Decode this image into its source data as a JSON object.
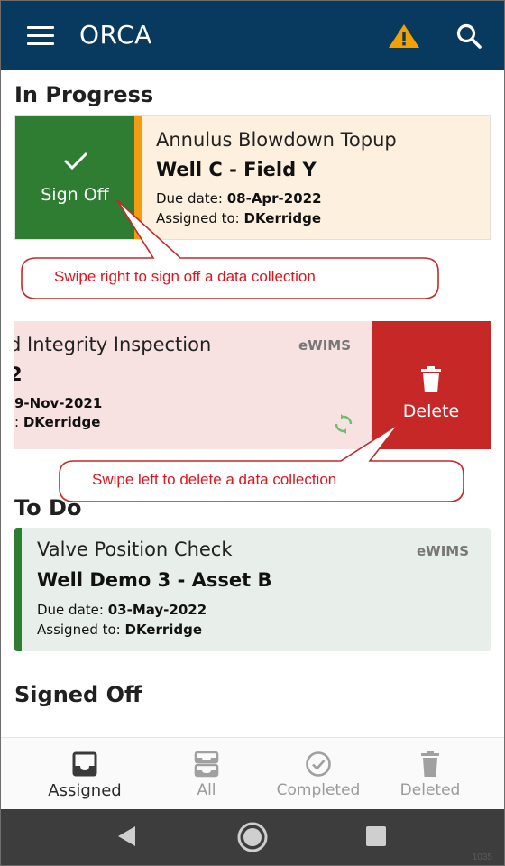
{
  "app_bar": {
    "title": "ORCA",
    "menu_icon": "hamburger-menu-icon",
    "alert_icon": "warning-triangle-icon",
    "search_icon": "search-icon",
    "background_color": "#073a5e",
    "alert_color": "#f5a000"
  },
  "sections": {
    "in_progress": "In Progress",
    "to_do": "To Do",
    "signed_off": "Signed Off"
  },
  "in_progress_cards": [
    {
      "type": "Annulus Blowdown Topup",
      "well": "Well C - Field Y",
      "due_label": "Due date:",
      "due_value": "08-Apr-2022",
      "assigned_label": "Assigned to:",
      "assigned_value": "DKerridge",
      "swipe_action": "Sign Off",
      "swipe_icon": "checkmark-icon",
      "accent_color": "#f39c12"
    },
    {
      "type": "d Integrity Inspection",
      "source": "eWIMS",
      "well": "2",
      "due_value": "9-Nov-2021",
      "assigned_label": ":",
      "assigned_value": "DKerridge",
      "sync_icon": "sync-icon",
      "swipe_action": "Delete",
      "swipe_icon": "trash-icon"
    }
  ],
  "callouts": {
    "sign_off_hint": "Swipe right to sign off a data collection",
    "delete_hint": "Swipe left to delete a data collection"
  },
  "to_do_cards": [
    {
      "type": "Valve Position Check",
      "source": "eWIMS",
      "well": "Well Demo 3 - Asset B",
      "due_label": "Due date:",
      "due_value": "03-May-2022",
      "assigned_label": "Assigned to:",
      "assigned_value": "DKerridge",
      "accent_color": "#2e7d32"
    }
  ],
  "bottom_nav": {
    "active": "Assigned",
    "items": [
      {
        "label": "Assigned",
        "icon": "inbox-icon"
      },
      {
        "label": "All",
        "icon": "stacked-inbox-icon"
      },
      {
        "label": "Completed",
        "icon": "check-circle-icon"
      },
      {
        "label": "Deleted",
        "icon": "trash-icon"
      }
    ]
  },
  "system_nav": {
    "back": "back-triangle-icon",
    "home": "home-circle-icon",
    "recents": "recents-square-icon",
    "corner_text": "1035"
  }
}
